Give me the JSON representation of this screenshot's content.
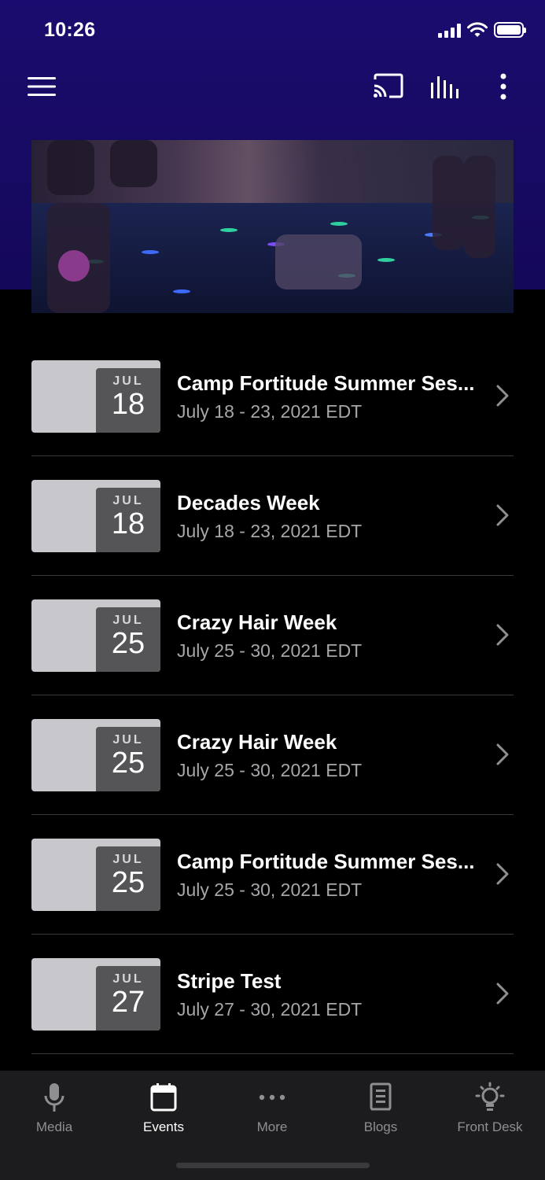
{
  "status_bar": {
    "time": "10:26"
  },
  "toolbar": {
    "menu_icon": "hamburger-menu-icon",
    "cast_icon": "cast-icon",
    "equalizer_icon": "audio-bars-icon",
    "more_icon": "vertical-ellipsis-icon"
  },
  "events": [
    {
      "month": "JUL",
      "day": "18",
      "title": "Camp Fortitude Summer Ses...",
      "dates": "July 18 - 23, 2021 EDT"
    },
    {
      "month": "JUL",
      "day": "18",
      "title": "Decades Week",
      "dates": "July 18 - 23, 2021 EDT"
    },
    {
      "month": "JUL",
      "day": "25",
      "title": "Crazy Hair Week",
      "dates": "July 25 - 30, 2021 EDT"
    },
    {
      "month": "JUL",
      "day": "25",
      "title": "Crazy Hair Week",
      "dates": "July 25 - 30, 2021 EDT"
    },
    {
      "month": "JUL",
      "day": "25",
      "title": "Camp Fortitude Summer Ses...",
      "dates": "July 25 - 30, 2021 EDT"
    },
    {
      "month": "JUL",
      "day": "27",
      "title": "Stripe Test",
      "dates": "July 27 - 30, 2021 EDT"
    }
  ],
  "tabs": [
    {
      "label": "Media",
      "icon": "microphone-icon",
      "active": false
    },
    {
      "label": "Events",
      "icon": "calendar-icon",
      "active": true
    },
    {
      "label": "More",
      "icon": "horizontal-ellipsis-icon",
      "active": false
    },
    {
      "label": "Blogs",
      "icon": "newspaper-icon",
      "active": false
    },
    {
      "label": "Front Desk",
      "icon": "lightbulb-icon",
      "active": false
    }
  ],
  "colors": {
    "header_bg": "#1a0c6e",
    "page_bg": "#000000",
    "tab_bar_bg": "#1c1c1e",
    "thumb_bg": "#c7c7cc",
    "date_badge_bg": "#555558",
    "secondary_text": "#a6a6ab",
    "inactive_tab": "#8e8e93"
  }
}
